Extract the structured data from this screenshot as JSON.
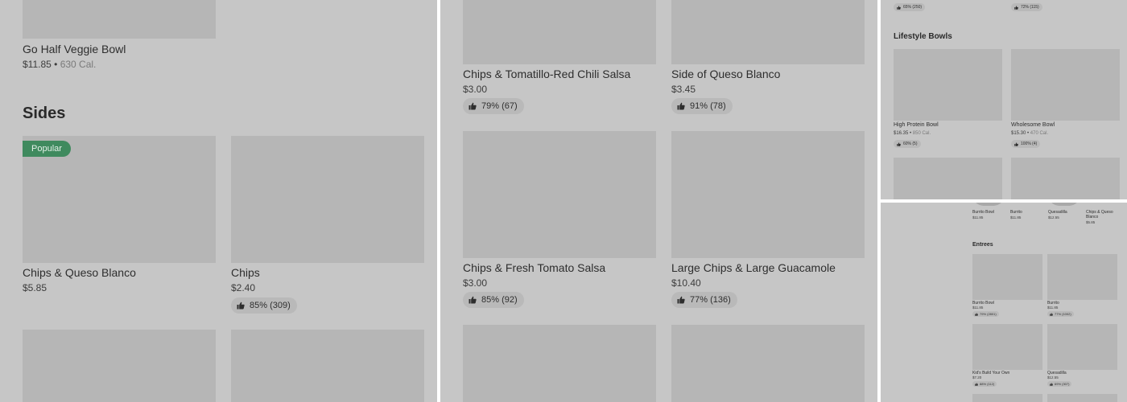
{
  "panel1": {
    "go_half": {
      "name": "Go Half Veggie Bowl",
      "price": "$11.85",
      "cal": "630 Cal."
    },
    "sides_heading": "Sides",
    "items": [
      {
        "name": "Chips & Queso Blanco",
        "price": "$5.85",
        "badge": "Popular"
      },
      {
        "name": "Chips",
        "price": "$2.40",
        "rating": "85% (309)"
      }
    ]
  },
  "panel2": {
    "items": [
      {
        "name": "Chips & Tomatillo-Red Chili Salsa",
        "price": "$3.00",
        "rating": "79% (67)"
      },
      {
        "name": "Side of Queso Blanco",
        "price": "$3.45",
        "rating": "91% (78)"
      },
      {
        "name": "Chips & Fresh Tomato Salsa",
        "price": "$3.00",
        "rating": "85% (92)"
      },
      {
        "name": "Large Chips & Large Guacamole",
        "price": "$10.40",
        "rating": "77% (136)"
      }
    ]
  },
  "panel3": {
    "top_ratings": [
      "65% (250)",
      "72% (115)"
    ],
    "heading": "Lifestyle Bowls",
    "items": [
      {
        "name": "High Protein Bowl",
        "price": "$16.35",
        "cal": "850 Cal.",
        "rating": "60% (5)"
      },
      {
        "name": "Wholesome Bowl",
        "price": "$15.30",
        "cal": "470 Cal.",
        "rating": "100% (4)"
      }
    ]
  },
  "panel4": {
    "top_items": [
      {
        "name": "Burrito Bowl",
        "price": "$11.85"
      },
      {
        "name": "Burrito",
        "price": "$11.85"
      },
      {
        "name": "Quesadilla",
        "price": "$12.55"
      },
      {
        "name": "Chips & Queso Blanco",
        "price": "$5.85"
      }
    ],
    "heading": "Entrees",
    "items": [
      {
        "name": "Burrito Bowl",
        "price": "$11.85",
        "rating": "79% (2801)"
      },
      {
        "name": "Burrito",
        "price": "$11.85",
        "rating": "77% (1002)"
      },
      {
        "name": "Kid's Build Your Own",
        "price": "$7.20",
        "rating": "88% (112)"
      },
      {
        "name": "Quesadilla",
        "price": "$12.55",
        "rating": "69% (307)"
      }
    ]
  },
  "icons": {
    "thumbs_up": "thumbs-up-icon"
  }
}
